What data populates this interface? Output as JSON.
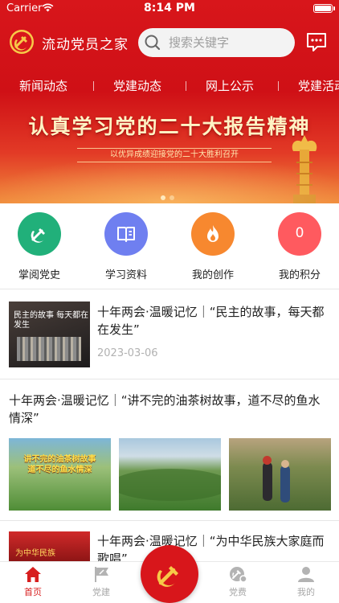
{
  "status_bar": {
    "carrier": "Carrier",
    "time": "8:14 PM"
  },
  "header": {
    "app_title": "流动党员之家",
    "search_placeholder": "搜索关键字"
  },
  "tabs": [
    "新闻动态",
    "党建动态",
    "网上公示",
    "党建活动"
  ],
  "banner": {
    "title": "认真学习党的二十大报告精神",
    "subtitle": "以优异成绩迎接党的二十大胜利召开",
    "page_dots": 2,
    "active_dot": 0
  },
  "quick_entries": [
    {
      "label": "掌阅党史",
      "icon": "party-emblem-icon",
      "color": "#21b07a"
    },
    {
      "label": "学习资料",
      "icon": "open-book-icon",
      "color": "#6f7ff0"
    },
    {
      "label": "我的创作",
      "icon": "flame-icon",
      "color": "#f7882f"
    },
    {
      "label": "我的积分",
      "icon": "points-icon",
      "color": "#ff5a5f",
      "value": "0"
    }
  ],
  "news": [
    {
      "title": "十年两会·温暖记忆｜“民主的故事，每天都在发生”",
      "date": "2023-03-06",
      "image_caption": "民主的故事 每天都在发生"
    },
    {
      "title": "十年两会·温暖记忆｜“讲不完的油茶树故事，道不尽的鱼水情深”",
      "image_caption": "讲不完的油茶树故事 道不尽的鱼水情深"
    },
    {
      "title": "十年两会·温暖记忆｜“为中华民族大家庭而歌唱”",
      "image_caption": "为中华民族"
    }
  ],
  "bottom_nav": [
    {
      "label": "首页",
      "icon": "home-icon",
      "active": true
    },
    {
      "label": "党建",
      "icon": "party-flag-icon",
      "active": false
    },
    {
      "label": "党费",
      "icon": "party-fee-icon",
      "active": false
    },
    {
      "label": "我的",
      "icon": "user-icon",
      "active": false
    }
  ],
  "colors": {
    "primary_red": "#d8161b",
    "active_tab": "#d71e1e",
    "inactive_tab": "#a8a8a8"
  }
}
